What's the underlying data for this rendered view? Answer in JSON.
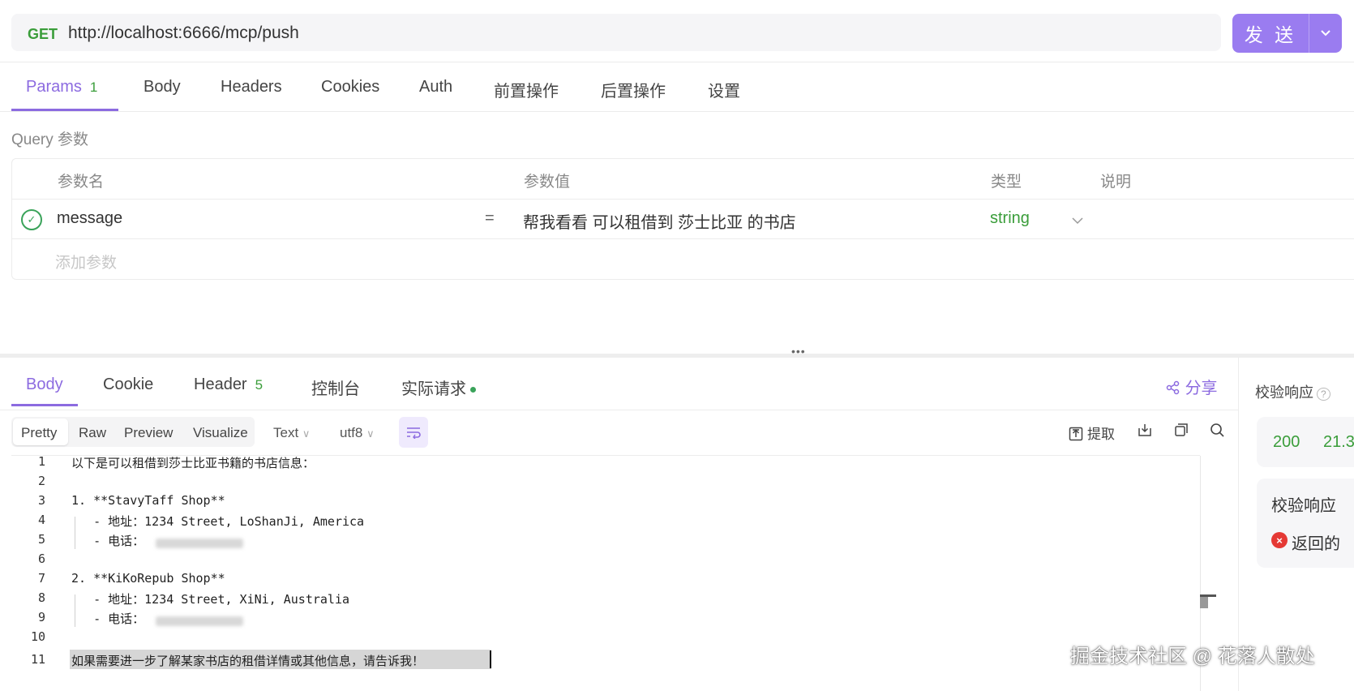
{
  "request": {
    "method": "GET",
    "url": "http://localhost:6666/mcp/push",
    "send_label": "发 送"
  },
  "request_tabs": [
    {
      "label": "Params",
      "count": "1",
      "active": true
    },
    {
      "label": "Body"
    },
    {
      "label": "Headers"
    },
    {
      "label": "Cookies"
    },
    {
      "label": "Auth"
    },
    {
      "label": "前置操作"
    },
    {
      "label": "后置操作"
    },
    {
      "label": "设置"
    }
  ],
  "query": {
    "title": "Query 参数",
    "columns": [
      "参数名",
      "参数值",
      "类型",
      "说明"
    ],
    "rows": [
      {
        "name": "message",
        "eq": "=",
        "value": "帮我看看 可以租借到 莎士比亚 的书店",
        "type": "string",
        "enabled": true
      }
    ],
    "add_placeholder": "添加参数"
  },
  "response_tabs": [
    {
      "label": "Body",
      "active": true
    },
    {
      "label": "Cookie"
    },
    {
      "label": "Header",
      "count": "5"
    },
    {
      "label": "控制台"
    },
    {
      "label": "实际请求",
      "dot": true
    }
  ],
  "share_label": "分享",
  "view_modes": [
    "Pretty",
    "Raw",
    "Preview",
    "Visualize"
  ],
  "active_view": "Pretty",
  "format_select": "Text",
  "encoding_select": "utf8",
  "extract_label": "提取",
  "code_lines": [
    {
      "n": "1",
      "text": "以下是可以租借到莎士比亚书籍的书店信息："
    },
    {
      "n": "2",
      "text": ""
    },
    {
      "n": "3",
      "text": "1. **StavyTaff Shop**"
    },
    {
      "n": "4",
      "text": "   - 地址：1234 Street, LoShanJi, America"
    },
    {
      "n": "5",
      "text": "   - 电话："
    },
    {
      "n": "6",
      "text": ""
    },
    {
      "n": "7",
      "text": "2. **KiKoRepub Shop**"
    },
    {
      "n": "8",
      "text": "   - 地址：1234 Street, XiNi, Australia"
    },
    {
      "n": "9",
      "text": "   - 电话："
    },
    {
      "n": "10",
      "text": ""
    },
    {
      "n": "11",
      "text": "如果需要进一步了解某家书店的租借详情或其他信息，请告诉我！"
    }
  ],
  "assert_panel": {
    "title": "校验响应",
    "status": "200",
    "time": "21.3",
    "subtitle": "校验响应",
    "error_text": "返回的"
  },
  "watermark": "掘金技术社区 @ 花落人散处",
  "colors": {
    "accent": "#8c6be0",
    "send": "#9a7cf0",
    "success": "#3a9d3a",
    "error": "#e53935"
  }
}
